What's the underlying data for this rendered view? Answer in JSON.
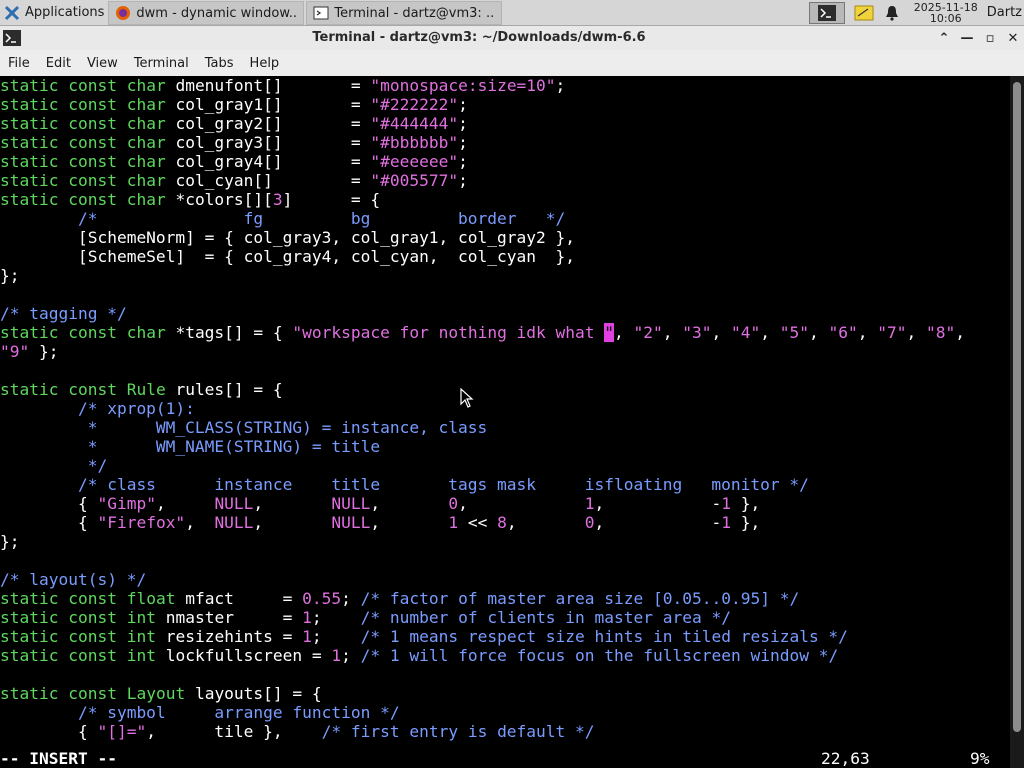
{
  "taskbar": {
    "apps_label": "Applications",
    "tasks": [
      {
        "label": "dwm - dynamic window..."
      },
      {
        "label": "Terminal - dartz@vm3: ..."
      }
    ],
    "clock_date": "2025-11-18",
    "clock_time": "10:06",
    "user": "Dartz"
  },
  "window": {
    "title": "Terminal - dartz@vm3: ~/Downloads/dwm-6.6",
    "controls": {
      "up": "⌃",
      "minimize": "—",
      "maximize": "▫",
      "close": "✕"
    }
  },
  "menu": [
    "File",
    "Edit",
    "View",
    "Terminal",
    "Tabs",
    "Help"
  ],
  "editor": {
    "lines": [
      "static const char dmenufont[]       = \"monospace:size=10\";",
      "static const char col_gray1[]       = \"#222222\";",
      "static const char col_gray2[]       = \"#444444\";",
      "static const char col_gray3[]       = \"#bbbbbb\";",
      "static const char col_gray4[]       = \"#eeeeee\";",
      "static const char col_cyan[]        = \"#005577\";",
      "static const char *colors[][3]      = {",
      "        /*               fg         bg         border   */",
      "        [SchemeNorm] = { col_gray3, col_gray1, col_gray2 },",
      "        [SchemeSel]  = { col_gray4, col_cyan,  col_cyan  },",
      "};",
      "",
      "/* tagging */",
      "static const char *tags[] = { \"workspace for nothing idk what \", \"2\", \"3\", \"4\", \"5\", \"6\", \"7\", \"8\",",
      "\"9\" };",
      "",
      "static const Rule rules[] = {",
      "        /* xprop(1):",
      "         *      WM_CLASS(STRING) = instance, class",
      "         *      WM_NAME(STRING) = title",
      "         */",
      "        /* class      instance    title       tags mask     isfloating   monitor */",
      "        { \"Gimp\",     NULL,       NULL,       0,            1,           -1 },",
      "        { \"Firefox\",  NULL,       NULL,       1 << 8,       0,           -1 },",
      "};",
      "",
      "/* layout(s) */",
      "static const float mfact     = 0.55; /* factor of master area size [0.05..0.95] */",
      "static const int nmaster     = 1;    /* number of clients in master area */",
      "static const int resizehints = 1;    /* 1 means respect size hints in tiled resizals */",
      "static const int lockfullscreen = 1; /* 1 will force focus on the fullscreen window */",
      "",
      "static const Layout layouts[] = {",
      "        /* symbol     arrange function */",
      "        { \"[]=\",      tile },    /* first entry is default */"
    ],
    "status_mode": "-- INSERT --",
    "status_pos": "22,63",
    "status_pct": "9%"
  },
  "colors": {
    "keyword": "#5fd75f",
    "string": "#e070e0",
    "comment": "#7a9cff",
    "cursor": "#e040e0"
  }
}
